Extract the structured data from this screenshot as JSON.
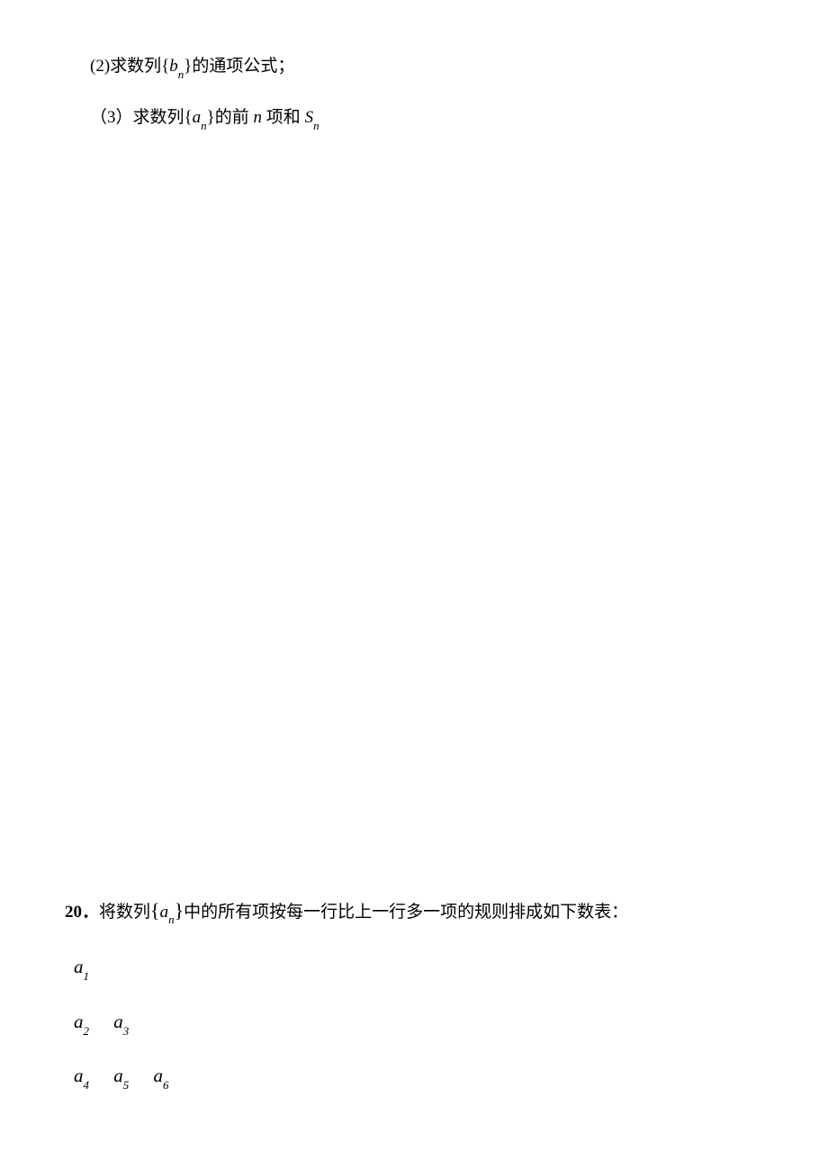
{
  "q19": {
    "part2": {
      "prefix": "(2)",
      "text1": "求数列",
      "seq_open": "{",
      "seq_var": "b",
      "seq_sub": "n",
      "seq_close": "}",
      "text2": "的通项公式；"
    },
    "part3": {
      "prefix": "（3）",
      "text1": "求数列",
      "seq_open": "{",
      "seq_var": "a",
      "seq_sub": "n",
      "seq_close": "}",
      "text2": "的前",
      "nvar": "n",
      "text3": "项和",
      "svar": "S",
      "ssub": "n"
    }
  },
  "q20": {
    "number": "20．",
    "text1": "将数列",
    "seq_open": "{",
    "seq_var": "a",
    "seq_sub": "n",
    "seq_close": "}",
    "text2": "中的所有项按每一行比上一行多一项的规则排成如下数表："
  },
  "triangle": {
    "rows": [
      [
        "a_1"
      ],
      [
        "a_2",
        "a_3"
      ],
      [
        "a_4",
        "a_5",
        "a_6"
      ]
    ],
    "row1": {
      "t1v": "a",
      "t1s": "1"
    },
    "row2": {
      "t1v": "a",
      "t1s": "2",
      "t2v": "a",
      "t2s": "3"
    },
    "row3": {
      "t1v": "a",
      "t1s": "4",
      "t2v": "a",
      "t2s": "5",
      "t3v": "a",
      "t3s": "6"
    }
  }
}
